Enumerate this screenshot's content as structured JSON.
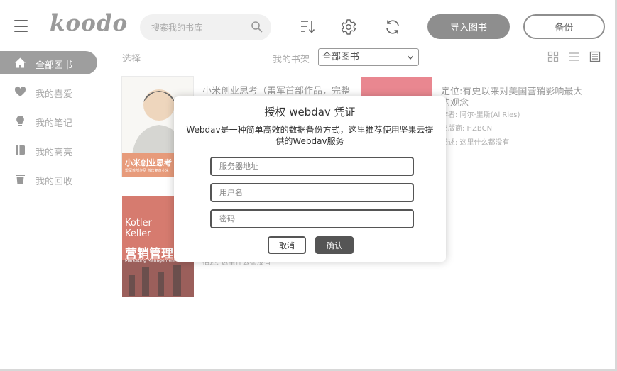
{
  "app": {
    "logo": "koodo"
  },
  "header": {
    "search_placeholder": "搜索我的书库",
    "import_label": "导入图书",
    "backup_label": "备份",
    "icons": [
      "sort-icon",
      "settings-icon",
      "sync-icon"
    ]
  },
  "sidebar": {
    "items": [
      {
        "label": "全部图书",
        "icon": "home-icon",
        "active": true
      },
      {
        "label": "我的喜爱",
        "icon": "heart-icon",
        "active": false
      },
      {
        "label": "我的笔记",
        "icon": "bulb-icon",
        "active": false
      },
      {
        "label": "我的高亮",
        "icon": "highlight-icon",
        "active": false
      },
      {
        "label": "我的回收",
        "icon": "trash-icon",
        "active": false
      }
    ]
  },
  "toolbar": {
    "select_label": "选择",
    "shelf_label": "我的书架",
    "shelf_selected": "全部图书"
  },
  "books": [
    {
      "title": "小米创业思考（雷军首部作品，完整",
      "cover_title": "小米创业思考",
      "cover_subtitle": "雷军首部作品 首次复盘小米",
      "cover_color": "#e07a50"
    },
    {
      "title": "定位:有史以来对美国营销影响最大的观念",
      "author": "作者: 阿尔·里斯(Al Ries)",
      "publisher": "出版商: HZBCN",
      "desc": "描述: 这里什么都没有",
      "cover_color": "#e25f6b"
    },
    {
      "title": "营销管理",
      "cover_top": "Kotler Keller",
      "cover_sub": "Marketing Management",
      "desc": "描述: 这里什么都没有",
      "cover_color": "#c85040"
    }
  ],
  "dialog": {
    "title": "授权 webdav 凭证",
    "description": "Webdav是一种简单高效的数据备份方式，这里推荐使用坚果云提供的Webdav服务",
    "server_placeholder": "服务器地址",
    "username_placeholder": "用户名",
    "password_placeholder": "密码",
    "cancel_label": "取消",
    "confirm_label": "确认"
  },
  "colors": {
    "accent": "#8e8e8e",
    "active_bg": "#9e9e9e",
    "dialog_button": "#555555"
  }
}
